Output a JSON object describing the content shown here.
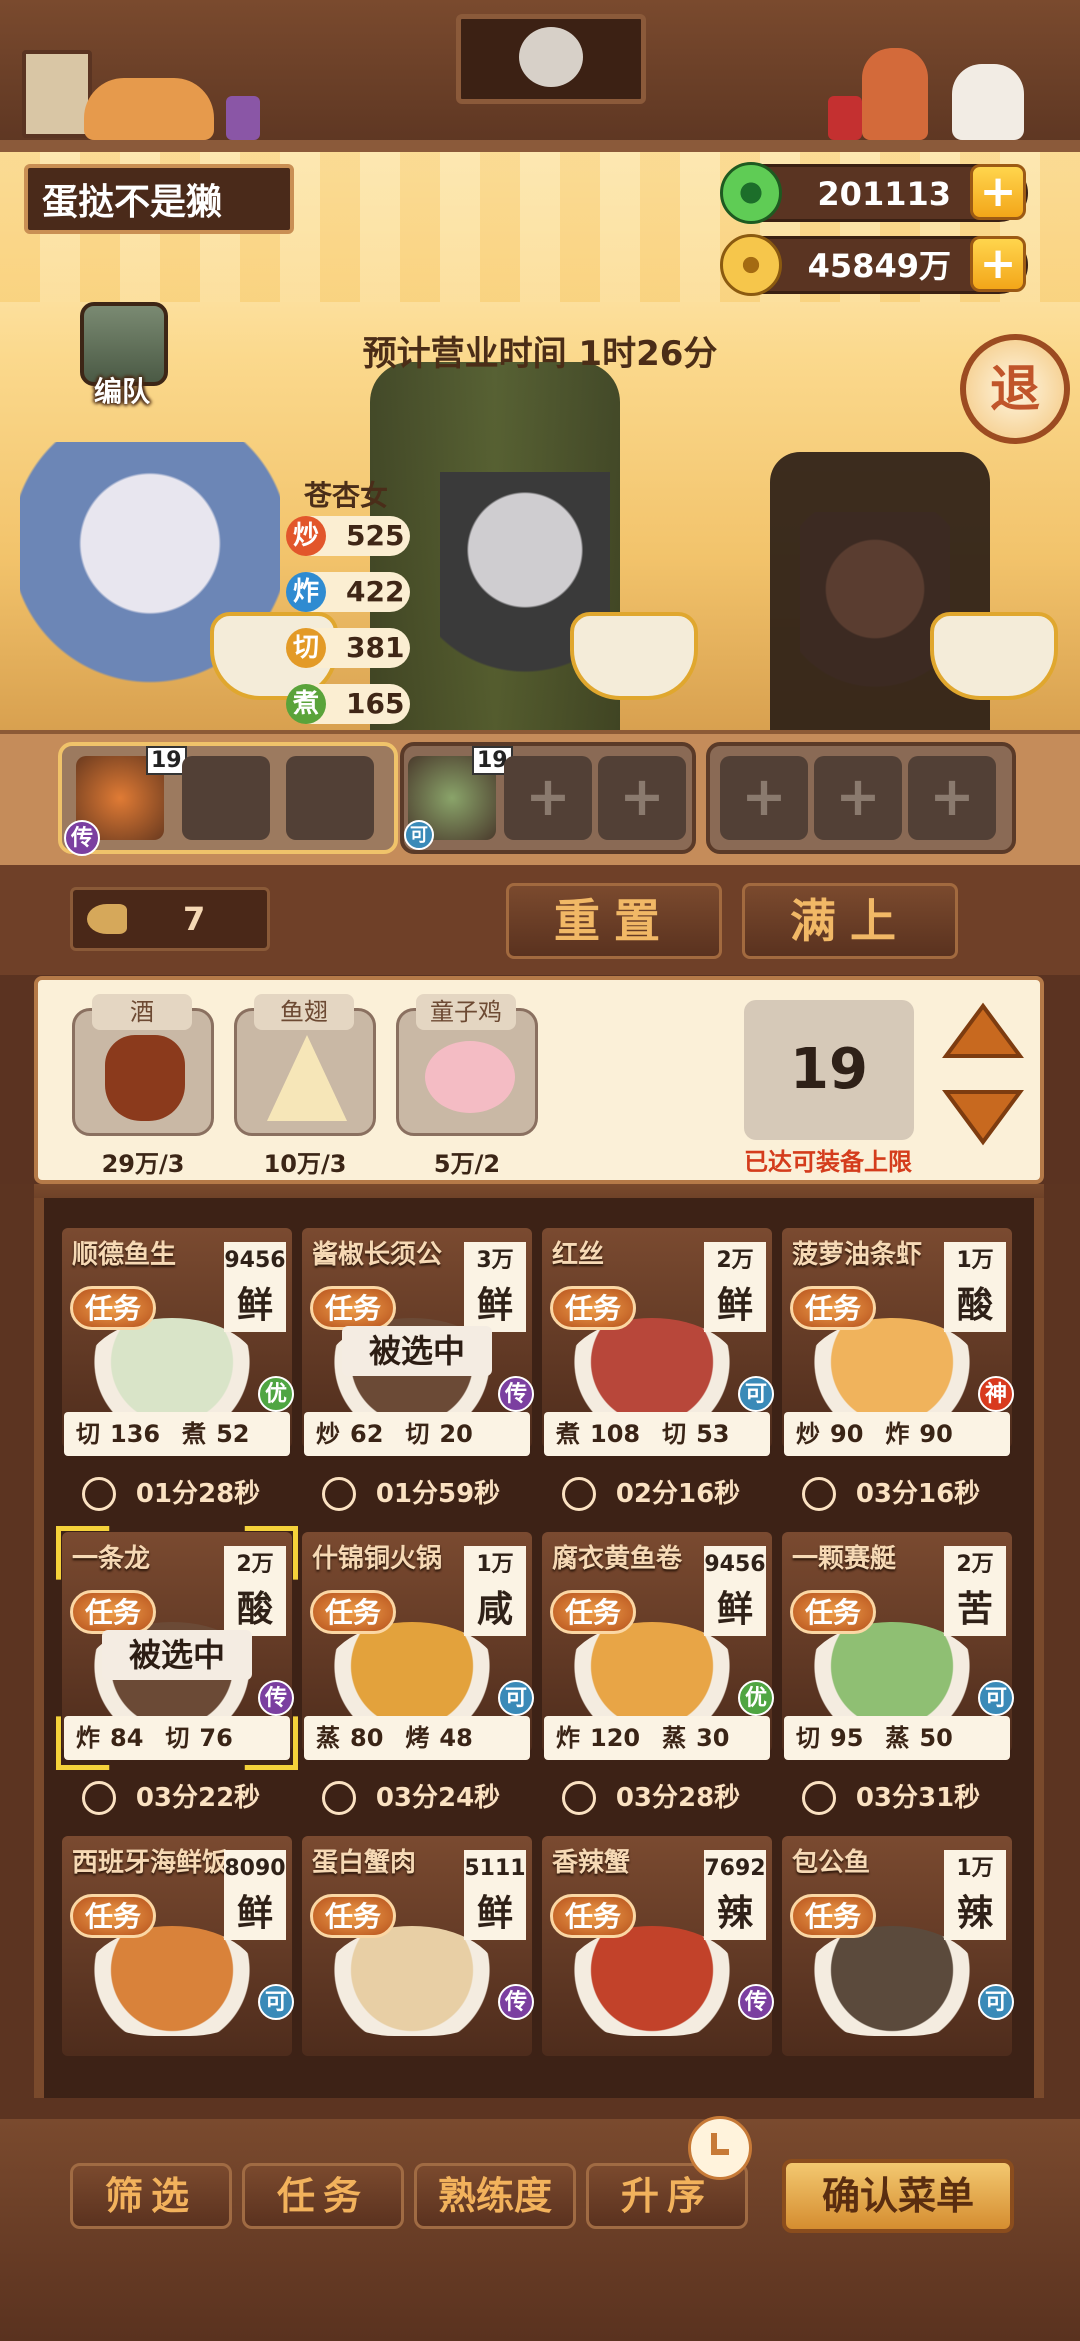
{
  "header": {
    "player_name": "蛋挞不是獭",
    "jade": "201113",
    "coins": "45849万",
    "plus": "+"
  },
  "scene": {
    "business_time": "预计营业时间  1时26分",
    "retreat": "退",
    "team_label": "编队",
    "chef": {
      "name": "苍杏女",
      "stats": [
        {
          "icon": "炒",
          "value": "525",
          "color": "#e2562b"
        },
        {
          "icon": "炸",
          "value": "422",
          "color": "#2f8bd1"
        },
        {
          "icon": "切",
          "value": "381",
          "color": "#e39a26"
        },
        {
          "icon": "煮",
          "value": "165",
          "color": "#5aa33a"
        }
      ]
    }
  },
  "slots": {
    "group1_count": "19",
    "group1_badge": "传",
    "group2_count": "19",
    "group2_badge": "可",
    "empty_plus": "+"
  },
  "midband": {
    "key_count": "7",
    "reset": "重置",
    "fill": "满上"
  },
  "ingredients": [
    {
      "name": "酒",
      "count": "29万/3"
    },
    {
      "name": "鱼翅",
      "count": "10万/3"
    },
    {
      "name": "童子鸡",
      "count": "5万/2"
    }
  ],
  "limit": {
    "value": "19",
    "note": "已达可装备上限"
  },
  "task_label": "任务",
  "selected_label": "被选中",
  "dishes": [
    {
      "name": "顺德鱼生",
      "price": "9456",
      "flavor": "鲜",
      "rarity": "优",
      "rarity_color": "#4fa542",
      "s1": "切",
      "v1": "136",
      "s2": "煮",
      "v2": "52",
      "time": "01分28秒",
      "selected": false,
      "img": "#d9e4c8"
    },
    {
      "name": "酱椒长须公",
      "price": "3万",
      "flavor": "鲜",
      "rarity": "传",
      "rarity_color": "#7b3fa0",
      "s1": "炒",
      "v1": "62",
      "s2": "切",
      "v2": "20",
      "time": "01分59秒",
      "selected": true,
      "img": "#6b4a36"
    },
    {
      "name": "红丝",
      "price": "2万",
      "flavor": "鲜",
      "rarity": "可",
      "rarity_color": "#3a8ab8",
      "s1": "煮",
      "v1": "108",
      "s2": "切",
      "v2": "53",
      "time": "02分16秒",
      "selected": false,
      "img": "#b8473a"
    },
    {
      "name": "菠萝油条虾",
      "price": "1万",
      "flavor": "酸",
      "rarity": "神",
      "rarity_color": "#d83a1e",
      "s1": "炒",
      "v1": "90",
      "s2": "炸",
      "v2": "90",
      "time": "03分16秒",
      "selected": false,
      "img": "#f0b35c"
    },
    {
      "name": "一条龙",
      "price": "2万",
      "flavor": "酸",
      "rarity": "传",
      "rarity_color": "#7b3fa0",
      "s1": "炸",
      "v1": "84",
      "s2": "切",
      "v2": "76",
      "time": "03分22秒",
      "selected": true,
      "img": "#6b4a36"
    },
    {
      "name": "什锦铜火锅",
      "price": "1万",
      "flavor": "咸",
      "rarity": "可",
      "rarity_color": "#3a8ab8",
      "s1": "蒸",
      "v1": "80",
      "s2": "烤",
      "v2": "48",
      "time": "03分24秒",
      "selected": false,
      "img": "#e3a23c"
    },
    {
      "name": "腐衣黄鱼卷",
      "price": "9456",
      "flavor": "鲜",
      "rarity": "优",
      "rarity_color": "#4fa542",
      "s1": "炸",
      "v1": "120",
      "s2": "蒸",
      "v2": "30",
      "time": "03分28秒",
      "selected": false,
      "img": "#e8a546"
    },
    {
      "name": "一颗赛艇",
      "price": "2万",
      "flavor": "苦",
      "rarity": "可",
      "rarity_color": "#3a8ab8",
      "s1": "切",
      "v1": "95",
      "s2": "蒸",
      "v2": "50",
      "time": "03分31秒",
      "selected": false,
      "img": "#8fbf73"
    },
    {
      "name": "西班牙海鲜饭",
      "price": "8090",
      "flavor": "鲜",
      "rarity": "可",
      "rarity_color": "#3a8ab8",
      "s1": "",
      "v1": "",
      "s2": "",
      "v2": "",
      "time": "",
      "selected": false,
      "img": "#d9823a"
    },
    {
      "name": "蛋白蟹肉",
      "price": "5111",
      "flavor": "鲜",
      "rarity": "传",
      "rarity_color": "#7b3fa0",
      "s1": "",
      "v1": "",
      "s2": "",
      "v2": "",
      "time": "",
      "selected": false,
      "img": "#e8cfa5"
    },
    {
      "name": "香辣蟹",
      "price": "7692",
      "flavor": "辣",
      "rarity": "传",
      "rarity_color": "#7b3fa0",
      "s1": "",
      "v1": "",
      "s2": "",
      "v2": "",
      "time": "",
      "selected": false,
      "img": "#c2422a"
    },
    {
      "name": "包公鱼",
      "price": "1万",
      "flavor": "辣",
      "rarity": "可",
      "rarity_color": "#3a8ab8",
      "s1": "",
      "v1": "",
      "s2": "",
      "v2": "",
      "time": "",
      "selected": false,
      "img": "#5b4a3c"
    }
  ],
  "bottom": {
    "filter": "筛选",
    "task": "任务",
    "proficiency": "熟练度",
    "sort": "升序",
    "confirm": "确认菜单"
  }
}
